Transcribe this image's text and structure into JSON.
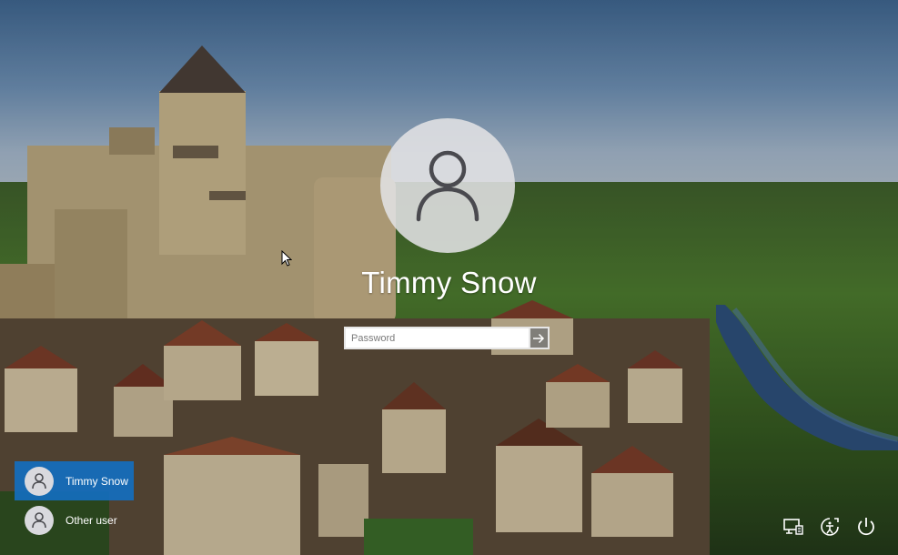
{
  "login": {
    "user_name": "Timmy Snow",
    "password_placeholder": "Password",
    "password_value": ""
  },
  "user_list": [
    {
      "label": "Timmy Snow",
      "selected": true
    },
    {
      "label": "Other user",
      "selected": false
    }
  ],
  "icons": {
    "avatar": "user-avatar-icon",
    "submit": "arrow-right-icon",
    "network": "network-icon",
    "ease_of_access": "ease-of-access-icon",
    "power": "power-icon"
  },
  "colors": {
    "selected_user_bg": "#146ebe",
    "avatar_bg": "#e1e1e4",
    "text": "#ffffff"
  }
}
